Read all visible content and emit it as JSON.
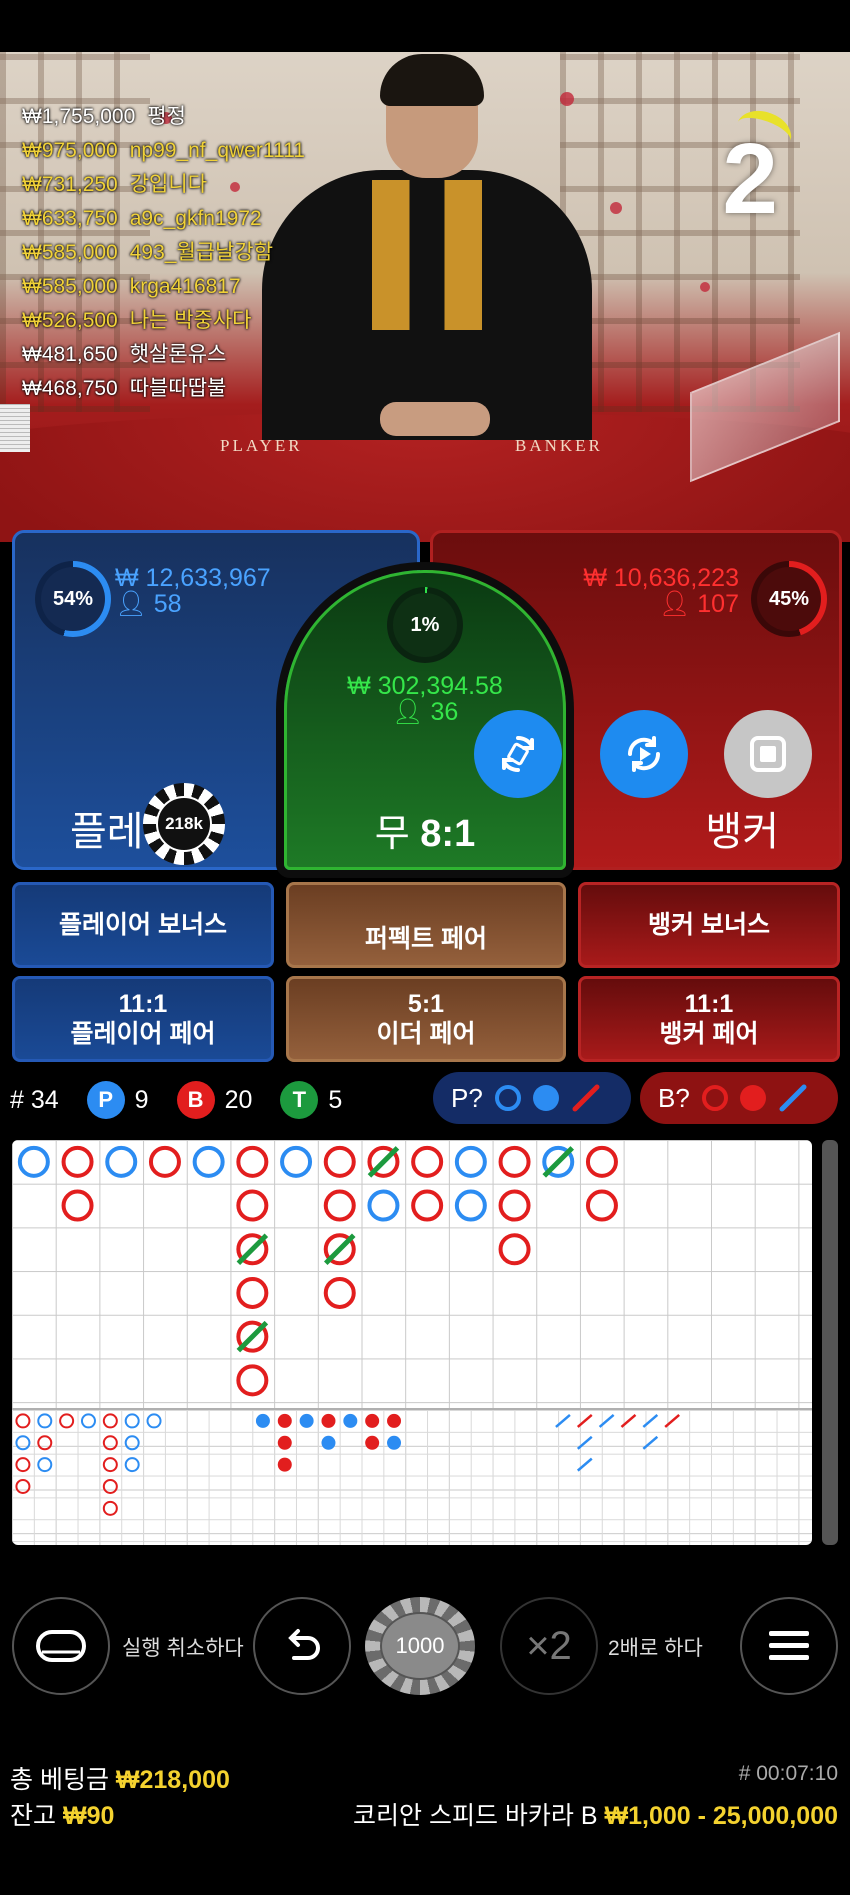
{
  "countdown": "2",
  "winners": [
    {
      "amount": "₩1,755,000",
      "name": "평정",
      "fade": true
    },
    {
      "amount": "₩975,000",
      "name": "np99_nf_qwer1111"
    },
    {
      "amount": "₩731,250",
      "name": "강입니다"
    },
    {
      "amount": "₩633,750",
      "name": "a9c_gkfn1972"
    },
    {
      "amount": "₩585,000",
      "name": "493_월급날강함"
    },
    {
      "amount": "₩585,000",
      "name": "krga416817"
    },
    {
      "amount": "₩526,500",
      "name": "나는 박중사다"
    },
    {
      "amount": "₩481,650",
      "name": "햇살론유스",
      "fade": true
    },
    {
      "amount": "₩468,750",
      "name": "따블따땁불",
      "fade": true
    }
  ],
  "felt": {
    "player": "PLAYER",
    "banker": "BANKER"
  },
  "player": {
    "percent": "54%",
    "amount": "₩ 12,633,967",
    "count": "58",
    "name": "플레이어",
    "chip": "218k",
    "color": "#2c8cf2"
  },
  "banker": {
    "percent": "45%",
    "amount": "₩ 10,636,223",
    "count": "107",
    "name": "뱅커",
    "color": "#e21e1e"
  },
  "tie": {
    "percent": "1%",
    "amount": "₩ 302,394.58",
    "count": "36",
    "name": "무",
    "payout": "8:1",
    "color": "#35e64a"
  },
  "side_bets": {
    "player_bonus": "플레이어 보너스",
    "perfect_pair": "퍼펙트 페어",
    "banker_bonus": "뱅커 보너스",
    "player_pair_odds": "11:1",
    "player_pair": "플레이어 페어",
    "either_pair_odds": "5:1",
    "either_pair": "이더 페어",
    "banker_pair_odds": "11:1",
    "banker_pair": "뱅커 페어"
  },
  "stats": {
    "round": "# 34",
    "p_letter": "P",
    "p_count": "9",
    "b_letter": "B",
    "b_count": "20",
    "t_letter": "T",
    "t_count": "5"
  },
  "predict": {
    "p_label": "P?",
    "b_label": "B?"
  },
  "big_road": [
    {
      "c": 0,
      "r": 0,
      "t": "P"
    },
    {
      "c": 1,
      "r": 0,
      "t": "B"
    },
    {
      "c": 1,
      "r": 1,
      "t": "B"
    },
    {
      "c": 2,
      "r": 0,
      "t": "P"
    },
    {
      "c": 3,
      "r": 0,
      "t": "B"
    },
    {
      "c": 4,
      "r": 0,
      "t": "P"
    },
    {
      "c": 5,
      "r": 0,
      "t": "B"
    },
    {
      "c": 5,
      "r": 1,
      "t": "B"
    },
    {
      "c": 5,
      "r": 2,
      "t": "B",
      "tie": true
    },
    {
      "c": 5,
      "r": 3,
      "t": "B"
    },
    {
      "c": 5,
      "r": 4,
      "t": "B",
      "tie": true
    },
    {
      "c": 5,
      "r": 5,
      "t": "B"
    },
    {
      "c": 6,
      "r": 0,
      "t": "P"
    },
    {
      "c": 7,
      "r": 0,
      "t": "B"
    },
    {
      "c": 7,
      "r": 1,
      "t": "B"
    },
    {
      "c": 7,
      "r": 2,
      "t": "B",
      "tie": true
    },
    {
      "c": 7,
      "r": 3,
      "t": "B"
    },
    {
      "c": 8,
      "r": 0,
      "t": "B",
      "tie": true
    },
    {
      "c": 8,
      "r": 1,
      "t": "P"
    },
    {
      "c": 9,
      "r": 0,
      "t": "B"
    },
    {
      "c": 9,
      "r": 1,
      "t": "B"
    },
    {
      "c": 10,
      "r": 0,
      "t": "P"
    },
    {
      "c": 10,
      "r": 1,
      "t": "P"
    },
    {
      "c": 11,
      "r": 0,
      "t": "B"
    },
    {
      "c": 11,
      "r": 1,
      "t": "B"
    },
    {
      "c": 11,
      "r": 2,
      "t": "B"
    },
    {
      "c": 12,
      "r": 0,
      "t": "P",
      "tie": true
    },
    {
      "c": 13,
      "r": 0,
      "t": "B"
    },
    {
      "c": 13,
      "r": 1,
      "t": "B"
    }
  ],
  "big_eye": [
    [
      "B",
      "P",
      "B",
      "P",
      "B",
      "P",
      "P"
    ],
    [
      "P",
      "B",
      "",
      "",
      "B",
      "P",
      ""
    ],
    [
      "B",
      "P",
      "",
      "",
      "B",
      "P",
      ""
    ],
    [
      "B",
      "",
      "",
      "",
      "B",
      "",
      ""
    ],
    [
      "",
      "",
      "",
      "",
      "B",
      "",
      ""
    ]
  ],
  "small_road": [
    {
      "c": 0,
      "r": 0,
      "t": "P"
    },
    {
      "c": 1,
      "r": 0,
      "t": "B"
    },
    {
      "c": 1,
      "r": 1,
      "t": "B"
    },
    {
      "c": 1,
      "r": 2,
      "t": "B"
    },
    {
      "c": 2,
      "r": 0,
      "t": "P"
    },
    {
      "c": 3,
      "r": 0,
      "t": "B"
    },
    {
      "c": 3,
      "r": 1,
      "t": "P"
    },
    {
      "c": 4,
      "r": 0,
      "t": "P"
    },
    {
      "c": 5,
      "r": 0,
      "t": "B"
    },
    {
      "c": 5,
      "r": 1,
      "t": "B"
    },
    {
      "c": 6,
      "r": 0,
      "t": "B"
    },
    {
      "c": 6,
      "r": 1,
      "t": "P"
    }
  ],
  "cockroach": [
    {
      "c": 0,
      "r": 0
    },
    {
      "c": 1,
      "r": 0
    },
    {
      "c": 1,
      "r": 1
    },
    {
      "c": 1,
      "r": 2
    },
    {
      "c": 2,
      "r": 0
    },
    {
      "c": 3,
      "r": 0
    },
    {
      "c": 4,
      "r": 0
    },
    {
      "c": 4,
      "r": 1
    },
    {
      "c": 5,
      "r": 0
    }
  ],
  "controls": {
    "undo": "실행 취소하다",
    "chip_value": "1000",
    "double_icon": "×2",
    "double": "2배로 하다"
  },
  "footer": {
    "total_bet_label": "총 베팅금",
    "total_bet": "₩218,000",
    "balance_label": "잔고",
    "balance": "₩90",
    "game_id": "# 00:07:10",
    "game_name": "코리안 스피드 바카라 B",
    "limits": "₩1,000 - 25,000,000"
  }
}
